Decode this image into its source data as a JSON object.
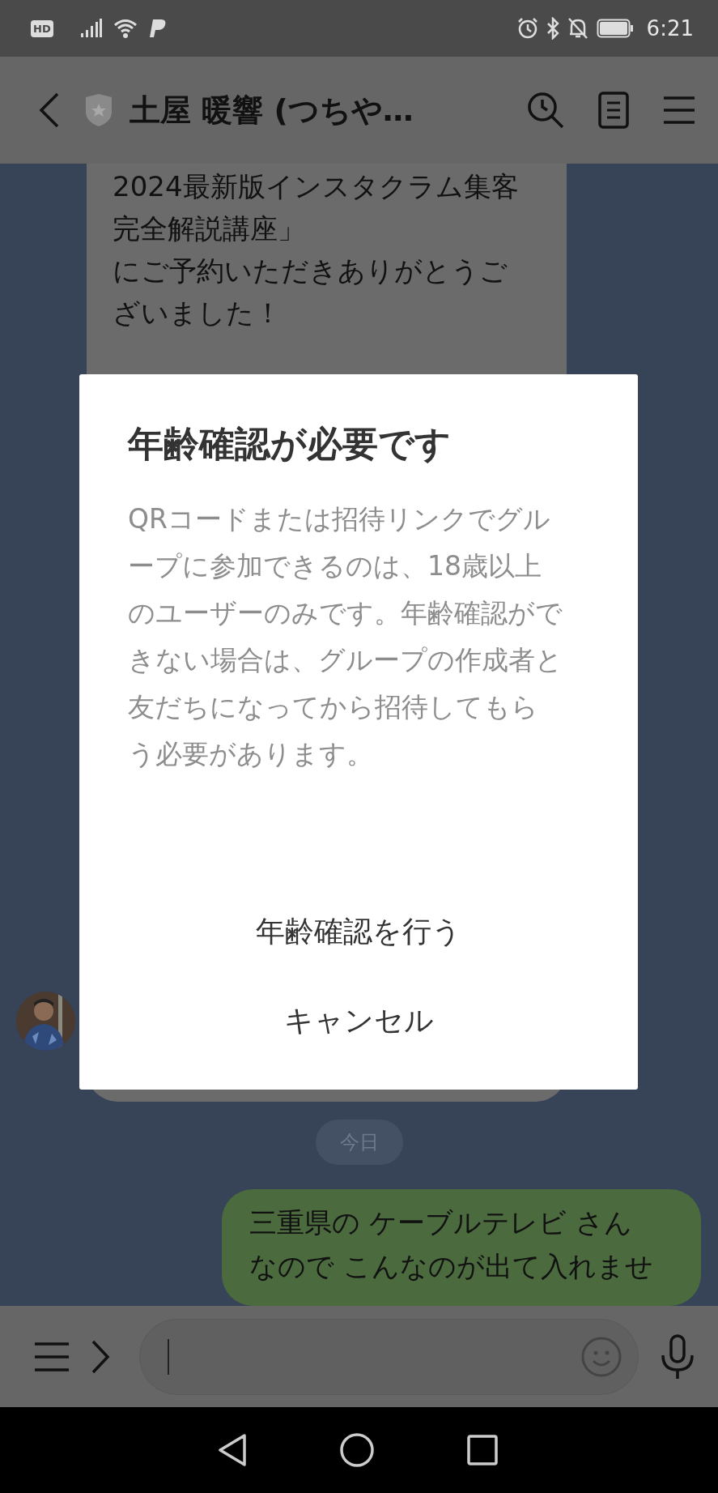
{
  "status_bar": {
    "hd_badge": "HD",
    "time": "6:21"
  },
  "header": {
    "title": "土屋 暖響 (つちや…"
  },
  "chat": {
    "messages": [
      {
        "kind": "incoming",
        "paragraphs": [
          [
            "2024最新版インスタクラム集客",
            "完全解説講座」",
            "にご予約いただきありがとうご",
            "ざいました！"
          ]
        ]
      },
      {
        "kind": "date",
        "text": "今日"
      },
      {
        "kind": "outgoing",
        "paragraphs": [
          [
            "三重県の ケーブルテレビ さん",
            "なので こんなのが出て入れませ"
          ]
        ]
      }
    ]
  },
  "dialog": {
    "title": "年齢確認が必要です",
    "body": "QRコードまたは招待リンクでグループに参加できるのは、18歳以上のユーザーのみです。年齢確認ができない場合は、グループの作成者と友だちになってから招待してもらう必要があります。",
    "buttons": [
      "年齢確認を行う",
      "キャンセル"
    ]
  }
}
